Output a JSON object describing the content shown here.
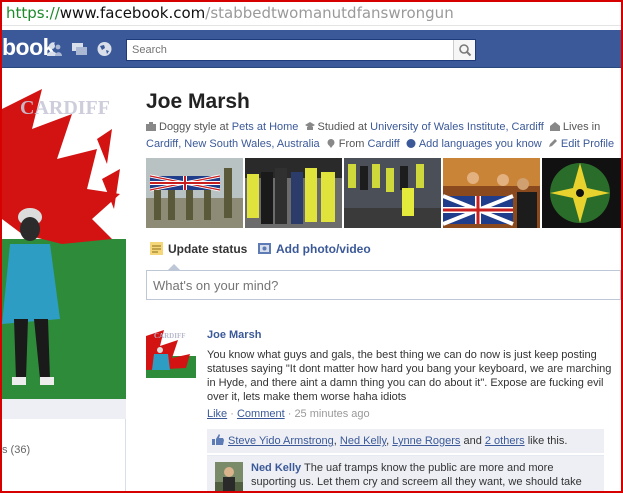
{
  "browser": {
    "url_scheme": "https://",
    "url_host": "www.facebook.com",
    "url_path": "/stabbedtwomanutdfanswrongun"
  },
  "header": {
    "logo": "book",
    "search_placeholder": "Search",
    "icons": [
      "friends-icon",
      "messages-icon",
      "globe-icon",
      "search-icon"
    ]
  },
  "left": {
    "count_text": "s (36)"
  },
  "profile": {
    "name": "Joe Marsh",
    "info": {
      "job_prefix": "Doggy style at",
      "job_place": "Pets at Home",
      "study_prefix": "Studied at",
      "study_place": "University of Wales Institute, Cardiff",
      "lives_prefix": "Lives in",
      "lives_place": "Cardiff, New South Wales, Australia",
      "from_prefix": "From",
      "from_place": "Cardiff",
      "add_languages": "Add languages you know",
      "edit_profile": "Edit Profile"
    }
  },
  "composer": {
    "update_status": "Update status",
    "add_photo": "Add photo/video",
    "placeholder": "What's on your mind?"
  },
  "story": {
    "author": "Joe Marsh",
    "text": "You know what guys and gals, the best thing we can do now is just keep posting statuses saying \"It dont matter how hard you bang your keyboard, we are marching in Hyde, and there aint a damn thing you can do about it\". Expose are fucking evil over it, lets make them worse haha idiots",
    "like": "Like",
    "comment": "Comment",
    "time": "25 minutes ago",
    "likes": {
      "person1": "Steve Yido Armstrong",
      "person2": "Ned Kelly",
      "person3": "Lynne Rogers",
      "and": "and",
      "others": "2 others",
      "suffix": "like this."
    },
    "comment_item": {
      "name": "Ned Kelly",
      "text": "The uaf tramps know the public are more and more suporting us. Let them cry and screem all they want, we should take"
    }
  },
  "colors": {
    "fb_blue": "#3b5998",
    "frame_red": "#d60000",
    "url_green": "#1d8a2b"
  }
}
